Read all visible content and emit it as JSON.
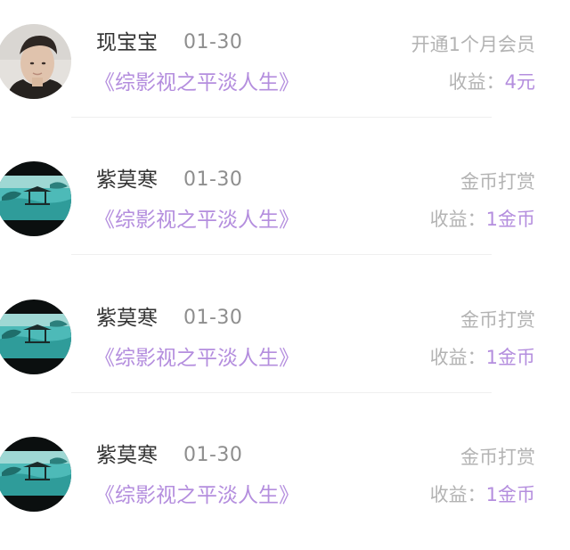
{
  "income_records": [
    {
      "user": "现宝宝",
      "date": "01-30",
      "book": "《综影视之平淡人生》",
      "action": "开通1个月会员",
      "earnings_label": "收益：",
      "earnings_value": "4元",
      "avatar": "man-portrait-avatar"
    },
    {
      "user": "紫莫寒",
      "date": "01-30",
      "book": "《综影视之平淡人生》",
      "action": "金币打赏",
      "earnings_label": "收益：",
      "earnings_value": "1金币",
      "avatar": "lake-pavilion-avatar"
    },
    {
      "user": "紫莫寒",
      "date": "01-30",
      "book": "《综影视之平淡人生》",
      "action": "金币打赏",
      "earnings_label": "收益：",
      "earnings_value": "1金币",
      "avatar": "lake-pavilion-avatar"
    },
    {
      "user": "紫莫寒",
      "date": "01-30",
      "book": "《综影视之平淡人生》",
      "action": "金币打赏",
      "earnings_label": "收益：",
      "earnings_value": "1金币",
      "avatar": "lake-pavilion-avatar"
    }
  ],
  "colors": {
    "name_text": "#333333",
    "date_text": "#8e8e8e",
    "book_title": "#b48ede",
    "muted_text": "#b3b3b3",
    "earnings_value": "#b48ede",
    "divider": "#efefef"
  }
}
